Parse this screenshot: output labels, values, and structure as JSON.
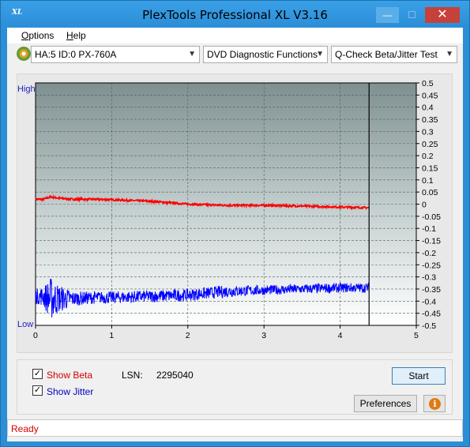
{
  "window": {
    "title": "PlexTools Professional XL V3.16",
    "app_icon": "XL",
    "controls": {
      "minimize": "—",
      "maximize": "☐",
      "close": "✕"
    }
  },
  "menu": {
    "options": {
      "first": "O",
      "rest": "ptions"
    },
    "help": {
      "first": "H",
      "rest": "elp"
    }
  },
  "toolbar": {
    "drive": "HA:5 ID:0  PX-760A",
    "function": "DVD Diagnostic Functions",
    "test": "Q-Check Beta/Jitter Test"
  },
  "graph": {
    "high_label": "High",
    "low_label": "Low"
  },
  "chart_data": {
    "type": "line",
    "x_ticks": [
      "0",
      "1",
      "2",
      "3",
      "4",
      "5"
    ],
    "xlim": [
      0,
      5
    ],
    "y_ticks": [
      "0.5",
      "0.45",
      "0.4",
      "0.35",
      "0.3",
      "0.25",
      "0.2",
      "0.15",
      "0.1",
      "0.05",
      "0",
      "-0.05",
      "-0.1",
      "-0.15",
      "-0.2",
      "-0.25",
      "-0.3",
      "-0.35",
      "-0.4",
      "-0.45",
      "-0.5"
    ],
    "ylim": [
      -0.5,
      0.5
    ],
    "end_x": 4.38,
    "grid": true,
    "series": [
      {
        "name": "Beta",
        "color": "#ff0000",
        "x": [
          0,
          0.1,
          0.2,
          0.3,
          0.5,
          0.8,
          1.0,
          1.5,
          2.0,
          2.5,
          3.0,
          3.5,
          4.0,
          4.38
        ],
        "y": [
          0.02,
          0.02,
          0.03,
          0.025,
          0.02,
          0.02,
          0.018,
          0.012,
          0.0,
          -0.005,
          -0.005,
          -0.008,
          -0.012,
          -0.015
        ]
      },
      {
        "name": "Jitter",
        "color": "#0000ff",
        "x": [
          0,
          0.1,
          0.2,
          0.3,
          0.5,
          0.8,
          1.0,
          1.5,
          2.0,
          2.5,
          3.0,
          3.5,
          4.0,
          4.38
        ],
        "y": [
          -0.38,
          -0.38,
          -0.39,
          -0.39,
          -0.39,
          -0.385,
          -0.385,
          -0.38,
          -0.375,
          -0.36,
          -0.355,
          -0.35,
          -0.345,
          -0.345
        ],
        "spread": [
          0.03,
          0.04,
          0.09,
          0.06,
          0.03,
          0.025,
          0.025,
          0.025,
          0.025,
          0.025,
          0.02,
          0.02,
          0.02,
          0.02
        ]
      }
    ]
  },
  "controls": {
    "show_beta": {
      "checked": true,
      "label": "Show Beta",
      "mnemonic": "B"
    },
    "show_jitter": {
      "checked": true,
      "label": "Show Jitter",
      "mnemonic": "J"
    },
    "lsn_label": "LSN:",
    "lsn_value": "2295040",
    "start_label": "Start",
    "preferences_label": "Preferences",
    "info_icon": "i"
  },
  "status": {
    "text": "Ready"
  },
  "colors": {
    "accent": "#2a8fd6",
    "beta": "#ff0000",
    "jitter": "#0000ff",
    "plot_bg_top": "#7f9090",
    "plot_bg_bottom": "#ffffff",
    "status_text": "#d40000",
    "axis_labels": "#2020c0"
  }
}
